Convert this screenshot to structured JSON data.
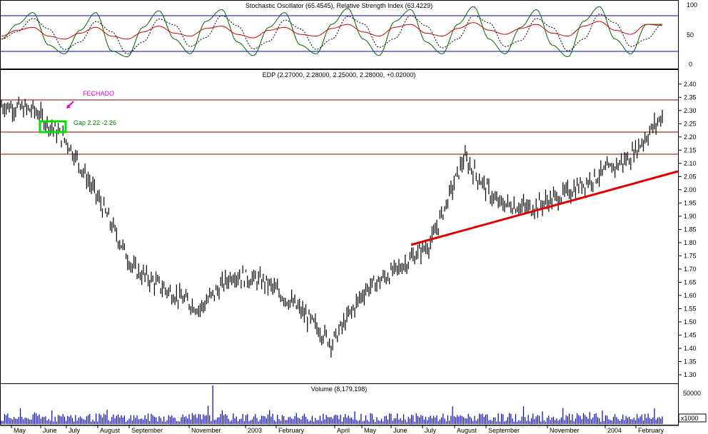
{
  "panels": {
    "oscillator": {
      "title": "Stochastic Oscillator (65.4545), Relative Strength Index (63.4229)",
      "ticks": [
        "100",
        "50",
        "0"
      ]
    },
    "price": {
      "title": "EDP (2.27000, 2.28000, 2.25000, 2.28000, +0.02000)",
      "ticks": [
        "2.40",
        "2.35",
        "2.30",
        "2.25",
        "2.20",
        "2.15",
        "2.10",
        "2.05",
        "2.00",
        "1.95",
        "1.90",
        "1.85",
        "1.80",
        "1.75",
        "1.70",
        "1.65",
        "1.60",
        "1.55",
        "1.50",
        "1.45",
        "1.40",
        "1.35",
        "1.30"
      ],
      "annotation_closed": "FECHADO",
      "annotation_gap": "Gap 2.22 -2.26"
    },
    "volume": {
      "title": "Volume (8,179,198)",
      "ticks": [
        "50000"
      ],
      "unit": "x1000"
    }
  },
  "x_axis": {
    "months": [
      "May",
      "June",
      "July",
      "August",
      "September",
      "November",
      "2003",
      "February",
      "April",
      "May",
      "June",
      "July",
      "August",
      "September",
      "November",
      "2004",
      "February"
    ]
  },
  "colors": {
    "background": "#ffffff",
    "price_bars": "#000000",
    "stochastic": "#006400",
    "stochastic_signal": "#000000",
    "rsi": "#d00000",
    "level_lines": "#0000c0",
    "resistance_lines": "#800000",
    "trendline": "#e00000",
    "gap_box": "#00e000",
    "gap_text": "#008000",
    "annotation": "#e000e0",
    "volume": "#0000c0"
  },
  "chart_data": [
    {
      "type": "line",
      "title": "Stochastic Oscillator (65.4545), Relative Strength Index (63.4229)",
      "ylim": [
        0,
        100
      ],
      "reference_levels": [
        80,
        20
      ],
      "series": [
        {
          "name": "Stochastic Oscillator",
          "values": [
            40,
            65,
            85,
            30,
            15,
            55,
            85,
            20,
            10,
            60,
            88,
            40,
            15,
            70,
            90,
            35,
            12,
            60,
            85,
            30,
            15,
            65,
            92,
            40,
            12,
            70,
            90,
            35,
            15,
            65,
            95,
            40,
            15,
            60,
            90,
            30,
            10,
            70,
            95,
            40,
            15,
            65,
            65
          ]
        },
        {
          "name": "Relative Strength Index",
          "values": [
            45,
            55,
            60,
            45,
            40,
            50,
            60,
            45,
            40,
            52,
            62,
            50,
            45,
            58,
            62,
            48,
            42,
            55,
            60,
            48,
            45,
            58,
            65,
            52,
            45,
            60,
            65,
            50,
            45,
            58,
            68,
            55,
            48,
            58,
            65,
            50,
            45,
            62,
            70,
            55,
            48,
            65,
            63
          ]
        }
      ]
    },
    {
      "type": "line",
      "title": "EDP (2.27000, 2.28000, 2.25000, 2.28000, +0.02000)",
      "x": [
        "May",
        "June",
        "July",
        "August",
        "September",
        "November",
        "2003",
        "February",
        "April",
        "May",
        "June",
        "July",
        "August",
        "September",
        "November",
        "2004",
        "February"
      ],
      "ylim": [
        1.3,
        2.42
      ],
      "series": [
        {
          "name": "EDP",
          "values": [
            2.32,
            2.3,
            2.18,
            1.95,
            1.7,
            1.62,
            1.55,
            1.68,
            1.65,
            1.55,
            1.42,
            1.62,
            1.7,
            1.8,
            2.12,
            1.95,
            1.93,
            1.98,
            2.05,
            2.12,
            2.28
          ]
        }
      ],
      "horizontal_lines": [
        2.34,
        2.22,
        2.14
      ],
      "trendline": {
        "from": [
          "June",
          1.8
        ],
        "to": [
          "February",
          2.07
        ]
      },
      "gap": [
        2.22,
        2.26
      ]
    },
    {
      "type": "bar",
      "title": "Volume (8,179,198)",
      "ylabel": "x1000",
      "ylim": [
        0,
        70000
      ],
      "peak_value": 65000
    }
  ]
}
